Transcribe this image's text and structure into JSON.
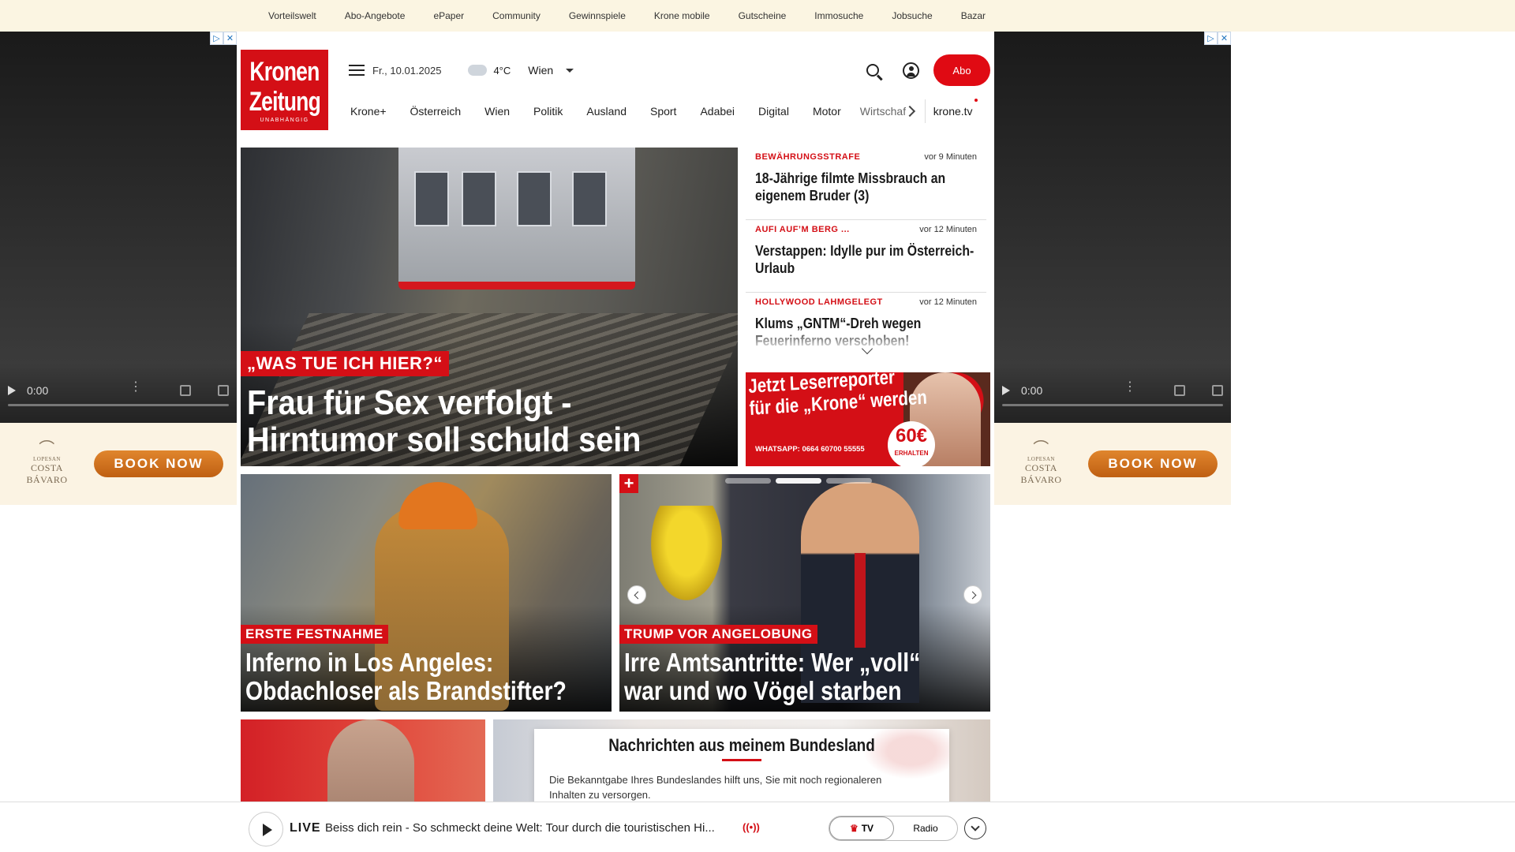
{
  "service_nav": [
    "Vorteilswelt",
    "Abo-Angebote",
    "ePaper",
    "Community",
    "Gewinnspiele",
    "Krone mobile",
    "Gutscheine",
    "Immosuche",
    "Jobsuche",
    "Bazar"
  ],
  "side_ad": {
    "video_time": "0:00",
    "brand_top": "LOPESAN",
    "brand": "COSTA BÁVARO",
    "cta": "BOOK NOW"
  },
  "logo": {
    "line1": "Kronen",
    "line2": "Zeitung",
    "tagline": "UNABHÄNGIG"
  },
  "header": {
    "date": "Fr., 10.01.2025",
    "temperature": "4°C",
    "city": "Wien",
    "abo_label": "Abo"
  },
  "main_nav": [
    "Krone+",
    "Österreich",
    "Wien",
    "Politik",
    "Ausland",
    "Sport",
    "Adabei",
    "Digital",
    "Motor"
  ],
  "main_nav_clipped": "Wirtschaft",
  "main_nav_tv": "krone.tv",
  "hero": {
    "kicker": "„WAS TUE ICH HIER?“",
    "title": "Frau für Sex verfolgt - Hirntumor soll schuld sein"
  },
  "ticker": [
    {
      "category": "BEWÄHRUNGSSTRAFE",
      "time": "vor 9 Minuten",
      "headline": "18-Jährige filmte Missbrauch an eigenem Bruder (3)"
    },
    {
      "category": "AUFI AUF’M BERG ...",
      "time": "vor 12 Minuten",
      "headline": "Verstappen: Idylle pur im Österreich-Urlaub"
    },
    {
      "category": "HOLLYWOOD LAHMGELEGT",
      "time": "vor 12 Minuten",
      "headline": "Klums „GNTM“-Dreh wegen Feuerinferno verschoben!"
    }
  ],
  "leserreporter": {
    "line1": "Jetzt Leserreporter",
    "line2": "für die „Krone“ werden",
    "whatsapp": "WHATSAPP: 0664 60700 55555",
    "amount": "60€",
    "amount_sub": "ERHALTEN"
  },
  "teasers": [
    {
      "kicker": "ERSTE FESTNAHME",
      "title": "Inferno in Los Angeles: Obdachloser als Brandstifter?"
    },
    {
      "kicker": "TRUMP VOR ANGELOBUNG",
      "title": "Irre Amtsantritte: Wer „voll“ war und wo Vögel starben"
    }
  ],
  "bundesland": {
    "title": "Nachrichten aus meinem Bundesland",
    "text": "Die Bekanntgabe Ihres Bundeslandes hilft uns, Sie mit noch regionaleren Inhalten zu versorgen."
  },
  "live": {
    "label": "LIVE",
    "text": "Beiss dich rein - So schmeckt deine Welt: Tour durch die touristischen Hi...",
    "tv": "TV",
    "radio": "Radio"
  }
}
